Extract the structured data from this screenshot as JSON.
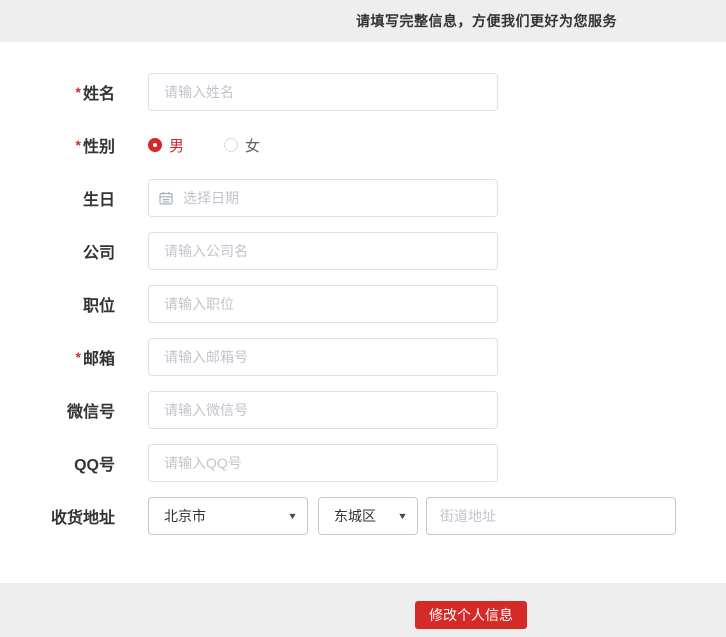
{
  "header": {
    "notice": "请填写完整信息，方便我们更好为您服务"
  },
  "form": {
    "required_marker": "*",
    "fields": [
      {
        "label": "姓名",
        "required": true,
        "type": "text",
        "placeholder": "请输入姓名"
      },
      {
        "label": "性别",
        "required": true,
        "type": "radio",
        "options": [
          {
            "label": "男",
            "checked": true
          },
          {
            "label": "女",
            "checked": false
          }
        ]
      },
      {
        "label": "生日",
        "required": false,
        "type": "date",
        "placeholder": "选择日期"
      },
      {
        "label": "公司",
        "required": false,
        "type": "text",
        "placeholder": "请输入公司名"
      },
      {
        "label": "职位",
        "required": false,
        "type": "text",
        "placeholder": "请输入职位"
      },
      {
        "label": "邮箱",
        "required": true,
        "type": "text",
        "placeholder": "请输入邮箱号"
      },
      {
        "label": "微信号",
        "required": false,
        "type": "text",
        "placeholder": "请输入微信号"
      },
      {
        "label": "QQ号",
        "required": false,
        "type": "text",
        "placeholder": "请输入QQ号"
      },
      {
        "label": "收货地址",
        "required": false,
        "type": "address",
        "province": "北京市",
        "district": "东城区",
        "street_placeholder": "街道地址"
      }
    ],
    "submit_label": "修改个人信息"
  },
  "icons": {
    "dropdown_arrow": "▼"
  },
  "colors": {
    "accent_red": "#d4282d",
    "button_red": "#d42a28",
    "bar_gray": "#eeeeee",
    "input_border": "#dde0e6",
    "placeholder_gray": "#c0c4cc"
  }
}
